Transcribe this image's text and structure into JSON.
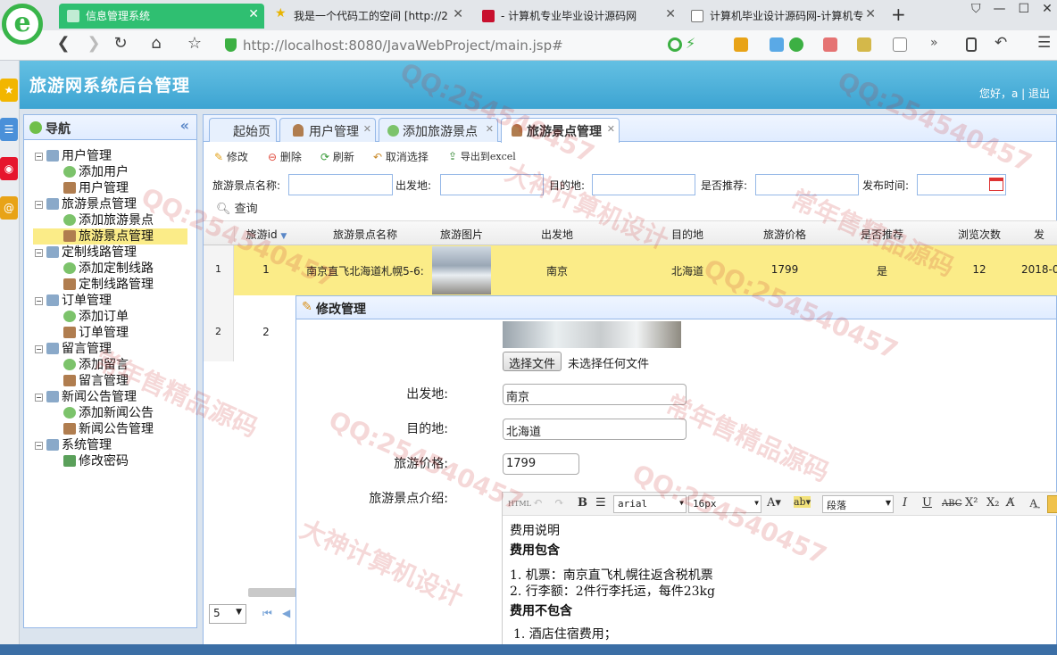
{
  "browser": {
    "tabs": [
      {
        "label": "信息管理系统",
        "active": true
      },
      {
        "label": "我是一个代码工的空间 [http://2",
        "active": false
      },
      {
        "label": "- 计算机专业毕业设计源码网",
        "active": false
      },
      {
        "label": "计算机毕业设计源码网-计算机专",
        "active": false
      }
    ],
    "new_tab": "+",
    "url_host": "http://localhost",
    "url_rest": ":8080/JavaWebProject/main.jsp#",
    "accent": "#3da4d2"
  },
  "app": {
    "title": "旅游网系统后台管理",
    "greeting": "您好，a",
    "logout": "退出"
  },
  "nav": {
    "title": "导航",
    "collapse": "«",
    "groups": [
      {
        "label": "用户管理",
        "items": [
          "添加用户",
          "用户管理"
        ]
      },
      {
        "label": "旅游景点管理",
        "items": [
          "添加旅游景点",
          "旅游景点管理"
        ]
      },
      {
        "label": "定制线路管理",
        "items": [
          "添加定制线路",
          "定制线路管理"
        ]
      },
      {
        "label": "订单管理",
        "items": [
          "添加订单",
          "订单管理"
        ]
      },
      {
        "label": "留言管理",
        "items": [
          "添加留言",
          "留言管理"
        ]
      },
      {
        "label": "新闻公告管理",
        "items": [
          "添加新闻公告",
          "新闻公告管理"
        ]
      },
      {
        "label": "系统管理",
        "items": [
          "修改密码"
        ]
      }
    ],
    "selected": "旅游景点管理"
  },
  "main": {
    "tabs": [
      {
        "label": "起始页",
        "closable": false
      },
      {
        "label": "用户管理",
        "closable": true
      },
      {
        "label": "添加旅游景点",
        "closable": true
      },
      {
        "label": "旅游景点管理",
        "closable": true,
        "active": true
      }
    ],
    "toolbar": [
      "修改",
      "删除",
      "刷新",
      "取消选择",
      "导出到excel"
    ],
    "filters": {
      "name_label": "旅游景点名称:",
      "from_label": "出发地:",
      "to_label": "目的地:",
      "recommend_label": "是否推荐:",
      "date_label": "发布时间:",
      "query": "查询"
    },
    "columns": [
      "旅游id",
      "旅游景点名称",
      "旅游图片",
      "出发地",
      "目的地",
      "旅游价格",
      "是否推荐",
      "浏览次数",
      "发"
    ],
    "rows": [
      {
        "num": "1",
        "id": "1",
        "name": "南京直飞北海道札幌5-6:",
        "from": "南京",
        "to": "北海道",
        "price": "1799",
        "recommend": "是",
        "views": "12",
        "date": "2018-0"
      },
      {
        "num": "2",
        "id": "2"
      }
    ],
    "page_size": "5"
  },
  "dialog": {
    "title": "修改管理",
    "choose_file": "选择文件",
    "no_file": "未选择任何文件",
    "from_label": "出发地:",
    "from_value": "南京",
    "to_label": "目的地:",
    "to_value": "北海道",
    "price_label": "旅游价格:",
    "price_value": "1799",
    "intro_label": "旅游景点介绍:",
    "editor": {
      "font": "arial",
      "size": "16px",
      "para": "段落",
      "lines": [
        "费用说明",
        "费用包含",
        "1.  机票：南京直飞札幌往返含税机票",
        "2.  行李额：2件行李托运，每件23kg",
        "费用不包含",
        "1. 酒店住宿费用；"
      ]
    }
  },
  "watermarks": [
    "QQ:254540457",
    "大神计算机设计",
    "常年售精品源码"
  ]
}
